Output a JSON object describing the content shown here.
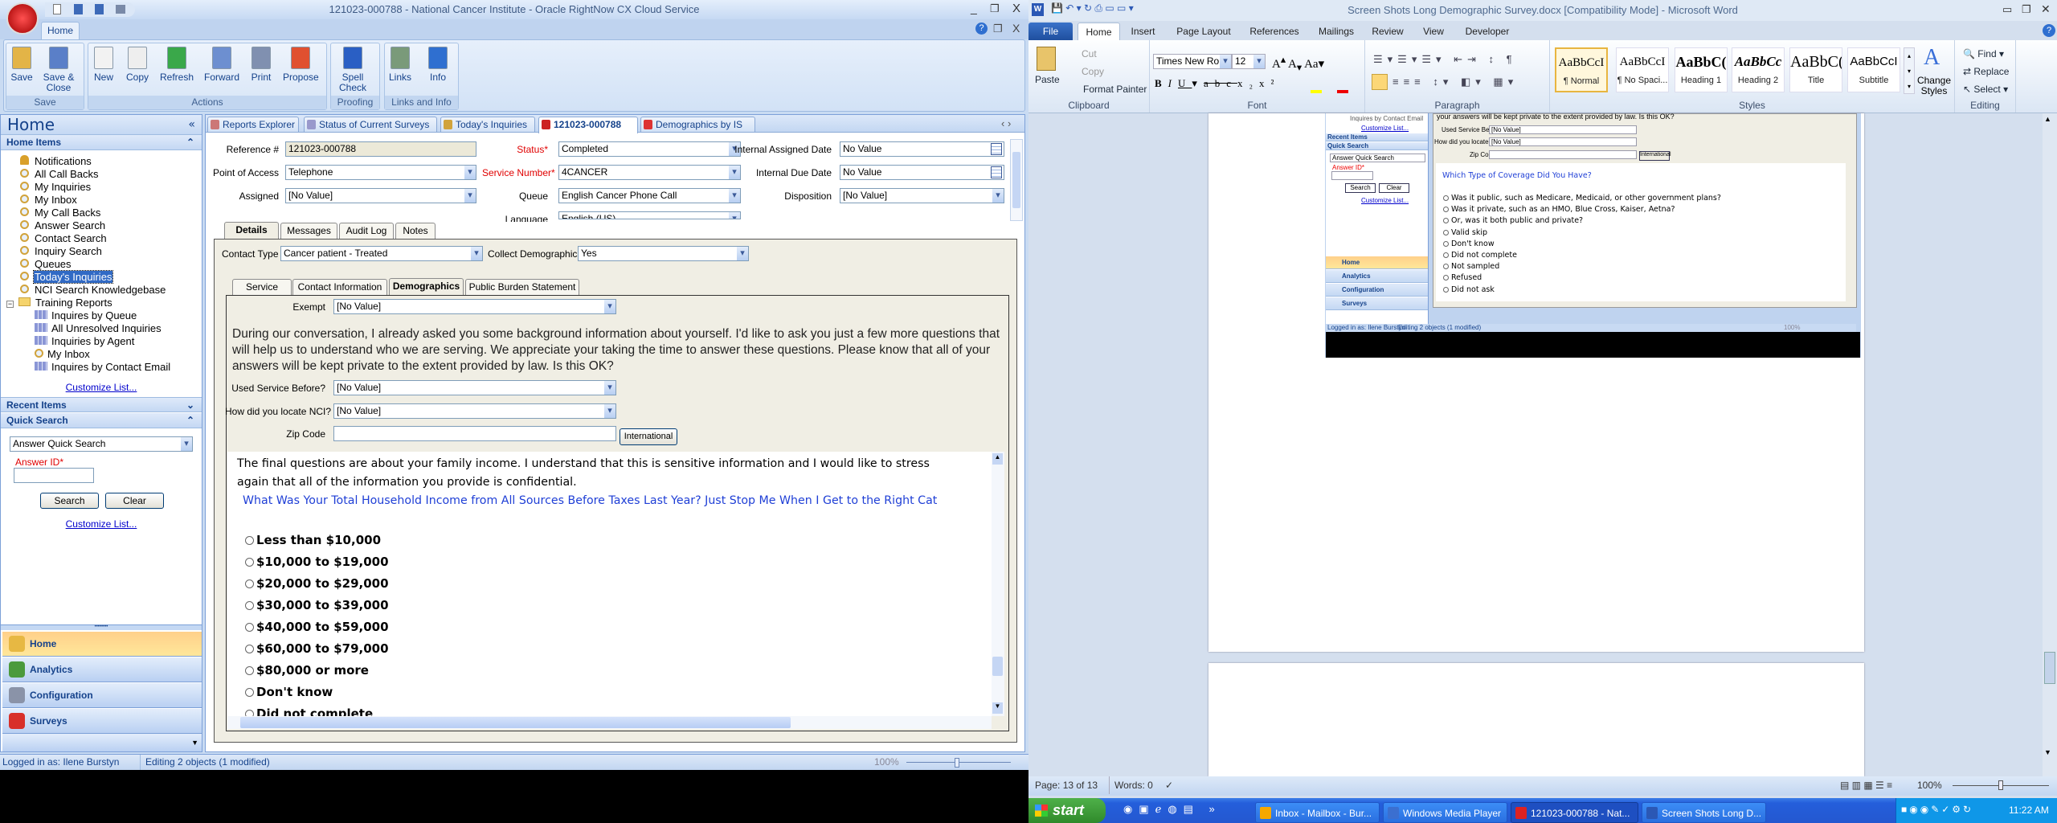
{
  "rightnow": {
    "window_title": "121023-000788  - National Cancer Institute - Oracle RightNow CX Cloud Service",
    "ribbon_tab": "Home",
    "ribbon_groups": [
      {
        "label": "Save",
        "buttons": [
          "Save",
          "Save & Close"
        ]
      },
      {
        "label": "Actions",
        "buttons": [
          "New",
          "Copy",
          "Refresh",
          "Forward",
          "Print",
          "Propose"
        ]
      },
      {
        "label": "Proofing",
        "buttons": [
          "Spell Check"
        ]
      },
      {
        "label": "Links and Info",
        "buttons": [
          "Links",
          "Info"
        ]
      }
    ],
    "sidebar": {
      "title": "Home",
      "home_items_header": "Home Items",
      "items": [
        {
          "label": "Notifications",
          "icon": "bell-icon"
        },
        {
          "label": "All Call Backs",
          "icon": "search-icon"
        },
        {
          "label": "My Inquiries",
          "icon": "search-icon"
        },
        {
          "label": "My Inbox",
          "icon": "search-icon"
        },
        {
          "label": "My Call Backs",
          "icon": "search-icon"
        },
        {
          "label": "Answer Search",
          "icon": "search-icon"
        },
        {
          "label": "Contact Search",
          "icon": "search-icon"
        },
        {
          "label": "Inquiry Search",
          "icon": "search-icon"
        },
        {
          "label": "Queues",
          "icon": "search-icon"
        },
        {
          "label": "Today's Inquiries",
          "icon": "search-icon",
          "selected": true
        },
        {
          "label": "NCI Search Knowledgebase",
          "icon": "search-icon"
        }
      ],
      "folder": {
        "label": "Training Reports",
        "items": [
          {
            "label": "Inquires by Queue",
            "icon": "report-icon"
          },
          {
            "label": "All Unresolved Inquiries",
            "icon": "report-icon"
          },
          {
            "label": "Inquiries by Agent",
            "icon": "report-icon"
          },
          {
            "label": "My Inbox",
            "icon": "search-icon"
          },
          {
            "label": "Inquires by Contact Email",
            "icon": "report-icon"
          }
        ]
      },
      "customize_link": "Customize List...",
      "recent_items_header": "Recent Items",
      "quick_search_header": "Quick Search",
      "quick_search_select": "Answer Quick Search",
      "answer_id_label": "Answer ID*",
      "answer_id_value": "",
      "search_button": "Search",
      "clear_button": "Clear",
      "nav_buttons": [
        "Home",
        "Analytics",
        "Configuration",
        "Surveys"
      ]
    },
    "content_tabs": [
      {
        "label": "Reports Explorer"
      },
      {
        "label": "Status of Current Surveys"
      },
      {
        "label": "Today's Inquiries"
      },
      {
        "label": "121023-000788",
        "active": true
      },
      {
        "label": "Demographics by IS"
      }
    ],
    "form": {
      "reference_label": "Reference #",
      "reference_value": "121023-000788",
      "status_label": "Status*",
      "status_value": "Completed",
      "iad_label": "Internal Assigned Date",
      "iad_value": "No Value",
      "poa_label": "Point of Access",
      "poa_value": "Telephone",
      "service_label": "Service Number*",
      "service_value": "4CANCER",
      "idd_label": "Internal Due Date",
      "idd_value": "No Value",
      "assigned_label": "Assigned",
      "assigned_value": "[No Value]",
      "queue_label": "Queue",
      "queue_value": "English Cancer Phone Call",
      "disposition_label": "Disposition",
      "disposition_value": "[No Value]",
      "language_label": "Language",
      "language_value": "English (US)"
    },
    "detail_tabs": [
      "Details",
      "Messages",
      "Audit Log",
      "Notes"
    ],
    "contact_type_label": "Contact Type",
    "contact_type_value": "Cancer patient - Treated",
    "collect_label": "Collect Demographics",
    "collect_value": "Yes",
    "sub_tabs": [
      "Service",
      "Contact Information",
      "Demographics",
      "Public Burden Statement"
    ],
    "exempt_label": "Exempt",
    "exempt_value": "[No Value]",
    "intro": "During our conversation, I already asked you some background information about yourself. I'd like to ask you just a few more questions that will help us to understand who we are serving. We appreciate your taking the time to answer these questions. Please know that all of your answers will be kept private to the extent provided by law. Is this OK?",
    "used_label": "Used Service Before?",
    "used_value": "[No Value]",
    "how_label": "How did you locate NCI?",
    "how_value": "[No Value]",
    "zip_label": "Zip Code",
    "zip_value": "",
    "international_button": "International",
    "survey": {
      "intro": "The final questions are about your family income. I understand that this is sensitive information and I would like to stress again that all of the information you provide is confidential.",
      "question": "What Was Your Total Household Income from All Sources Before Taxes Last Year? Just Stop Me When I Get to the Right Cat",
      "options": [
        "Less than $10,000",
        "$10,000 to $19,000",
        "$20,000 to $29,000",
        "$30,000 to $39,000",
        "$40,000 to $59,000",
        "$60,000 to $79,000",
        "$80,000 or more",
        "Don't know",
        "Did not complete"
      ]
    },
    "status_bar": {
      "logged_in": "Logged in as: Ilene Burstyn",
      "editing": "Editing 2 objects (1 modified)",
      "zoom": "100%"
    }
  },
  "word": {
    "window_title": "Screen Shots Long Demographic Survey.docx [Compatibility Mode]  -  Microsoft Word",
    "tabs": [
      "File",
      "Home",
      "Insert",
      "Page Layout",
      "References",
      "Mailings",
      "Review",
      "View",
      "Developer"
    ],
    "active_tab": "Home",
    "clipboard": {
      "paste": "Paste",
      "cut": "Cut",
      "copy": "Copy",
      "format_painter": "Format Painter",
      "label": "Clipboard"
    },
    "font": {
      "name": "Times New Rom",
      "size": "12",
      "label": "Font"
    },
    "paragraph_label": "Paragraph",
    "styles": [
      {
        "preview": "AaBbCcI",
        "name": "¶ Normal",
        "selected": true
      },
      {
        "preview": "AaBbCcI",
        "name": "¶ No Spaci..."
      },
      {
        "preview": "AaBbC(",
        "name": "Heading 1"
      },
      {
        "preview": "AaBbCc",
        "name": "Heading 2"
      },
      {
        "preview": "AaBbC(",
        "name": "Title"
      },
      {
        "preview": "AaBbCcI",
        "name": "Subtitle"
      }
    ],
    "change_styles": "Change Styles",
    "styles_label": "Styles",
    "editing": {
      "find": "Find",
      "replace": "Replace",
      "select": "Select",
      "label": "Editing"
    },
    "embedded": {
      "top_text": "your answers will be kept private to the extent provided by law. Is this OK?",
      "inquires_email": "Inquires by Contact Email",
      "customize": "Customize List...",
      "recent": "Recent Items",
      "quick": "Quick Search",
      "quick_select": "Answer Quick Search",
      "answer_id": "Answer ID*",
      "search": "Search",
      "clear": "Clear",
      "nav": [
        "Home",
        "Analytics",
        "Configuration",
        "Surveys"
      ],
      "used_label": "Used Service Before?",
      "used_value": "[No Value]",
      "how_label": "How did you locate NCI?",
      "how_value": "[No Value]",
      "zip_label": "Zip Code",
      "international": "International",
      "question": "Which Type of Coverage Did You Have?",
      "options": [
        "Was it public, such as Medicare, Medicaid, or other government plans?",
        "Was it private, such as an HMO, Blue Cross, Kaiser, Aetna?",
        "Or, was it both public and private?",
        "Valid skip",
        "Don't know",
        "Did not complete",
        "Not sampled",
        "Refused",
        "Did not ask"
      ],
      "status_logged": "Logged in as: Ilene Burstyn",
      "status_editing": "Editing 2 objects (1 modified)",
      "status_zoom": "100%"
    },
    "status_bar": {
      "page": "Page: 13 of 13",
      "words": "Words: 0",
      "zoom": "100%"
    }
  },
  "taskbar": {
    "start": "start",
    "items": [
      {
        "label": "Inbox - Mailbox - Bur...",
        "icon": "outlook-icon"
      },
      {
        "label": "Windows Media Player",
        "icon": "media-player-icon"
      },
      {
        "label": "121023-000788 - Nat...",
        "icon": "rightnow-icon",
        "active": true
      },
      {
        "label": "Screen Shots Long D...",
        "icon": "word-icon"
      }
    ],
    "clock": "11:22 AM"
  },
  "colors": {
    "accent": "#15428b",
    "required": "#e00000",
    "selection": "#316ac5",
    "survey_question": "#1f3fd6",
    "nav_active": "#ffd08a"
  }
}
